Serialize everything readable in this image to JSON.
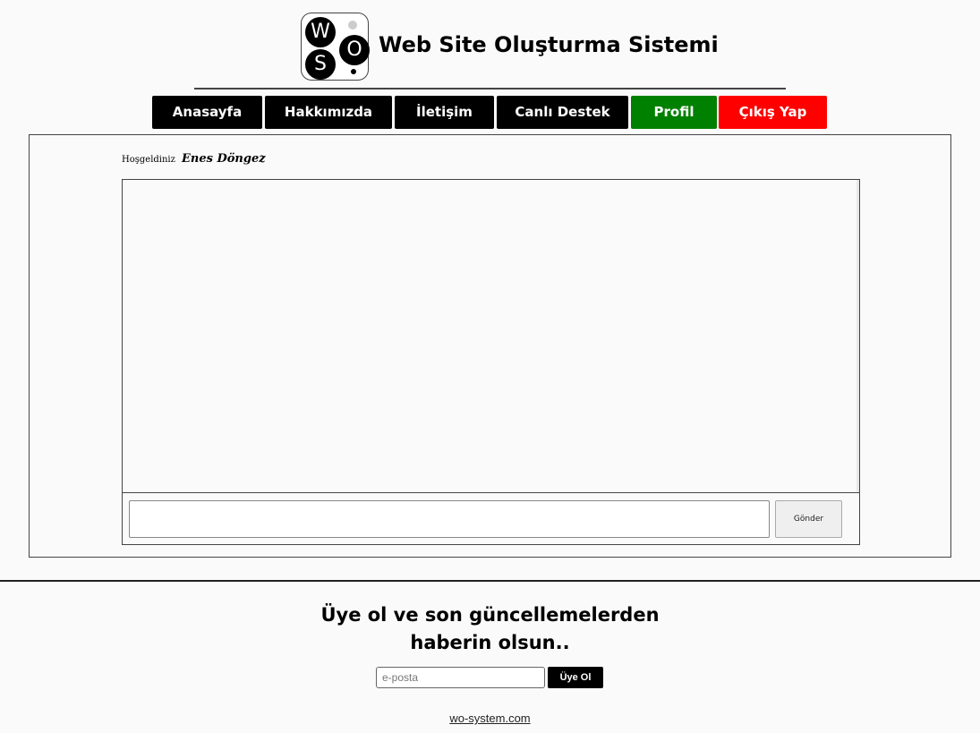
{
  "header": {
    "logo_letters": [
      "W",
      "O",
      "S"
    ],
    "title": "Web Site Oluşturma Sistemi"
  },
  "nav": {
    "items": [
      {
        "label": "Anasayfa",
        "color": "#000000"
      },
      {
        "label": "Hakkımızda",
        "color": "#000000"
      },
      {
        "label": "İletişim",
        "color": "#000000"
      },
      {
        "label": "Canlı Destek",
        "color": "#000000"
      },
      {
        "label": "Profil",
        "color": "#008000"
      },
      {
        "label": "Çıkış Yap",
        "color": "#ff0000"
      }
    ]
  },
  "main": {
    "welcome_prefix": "Hoşgeldiniz",
    "user_name": "Enes Döngez",
    "message_value": "",
    "send_label": "Gönder"
  },
  "footer": {
    "newsletter_line1": "Üye ol ve son güncellemelerden",
    "newsletter_line2": "haberin olsun..",
    "email_placeholder": "e-posta",
    "subscribe_label": "Üye Ol",
    "site_link": "wo-system.com"
  }
}
